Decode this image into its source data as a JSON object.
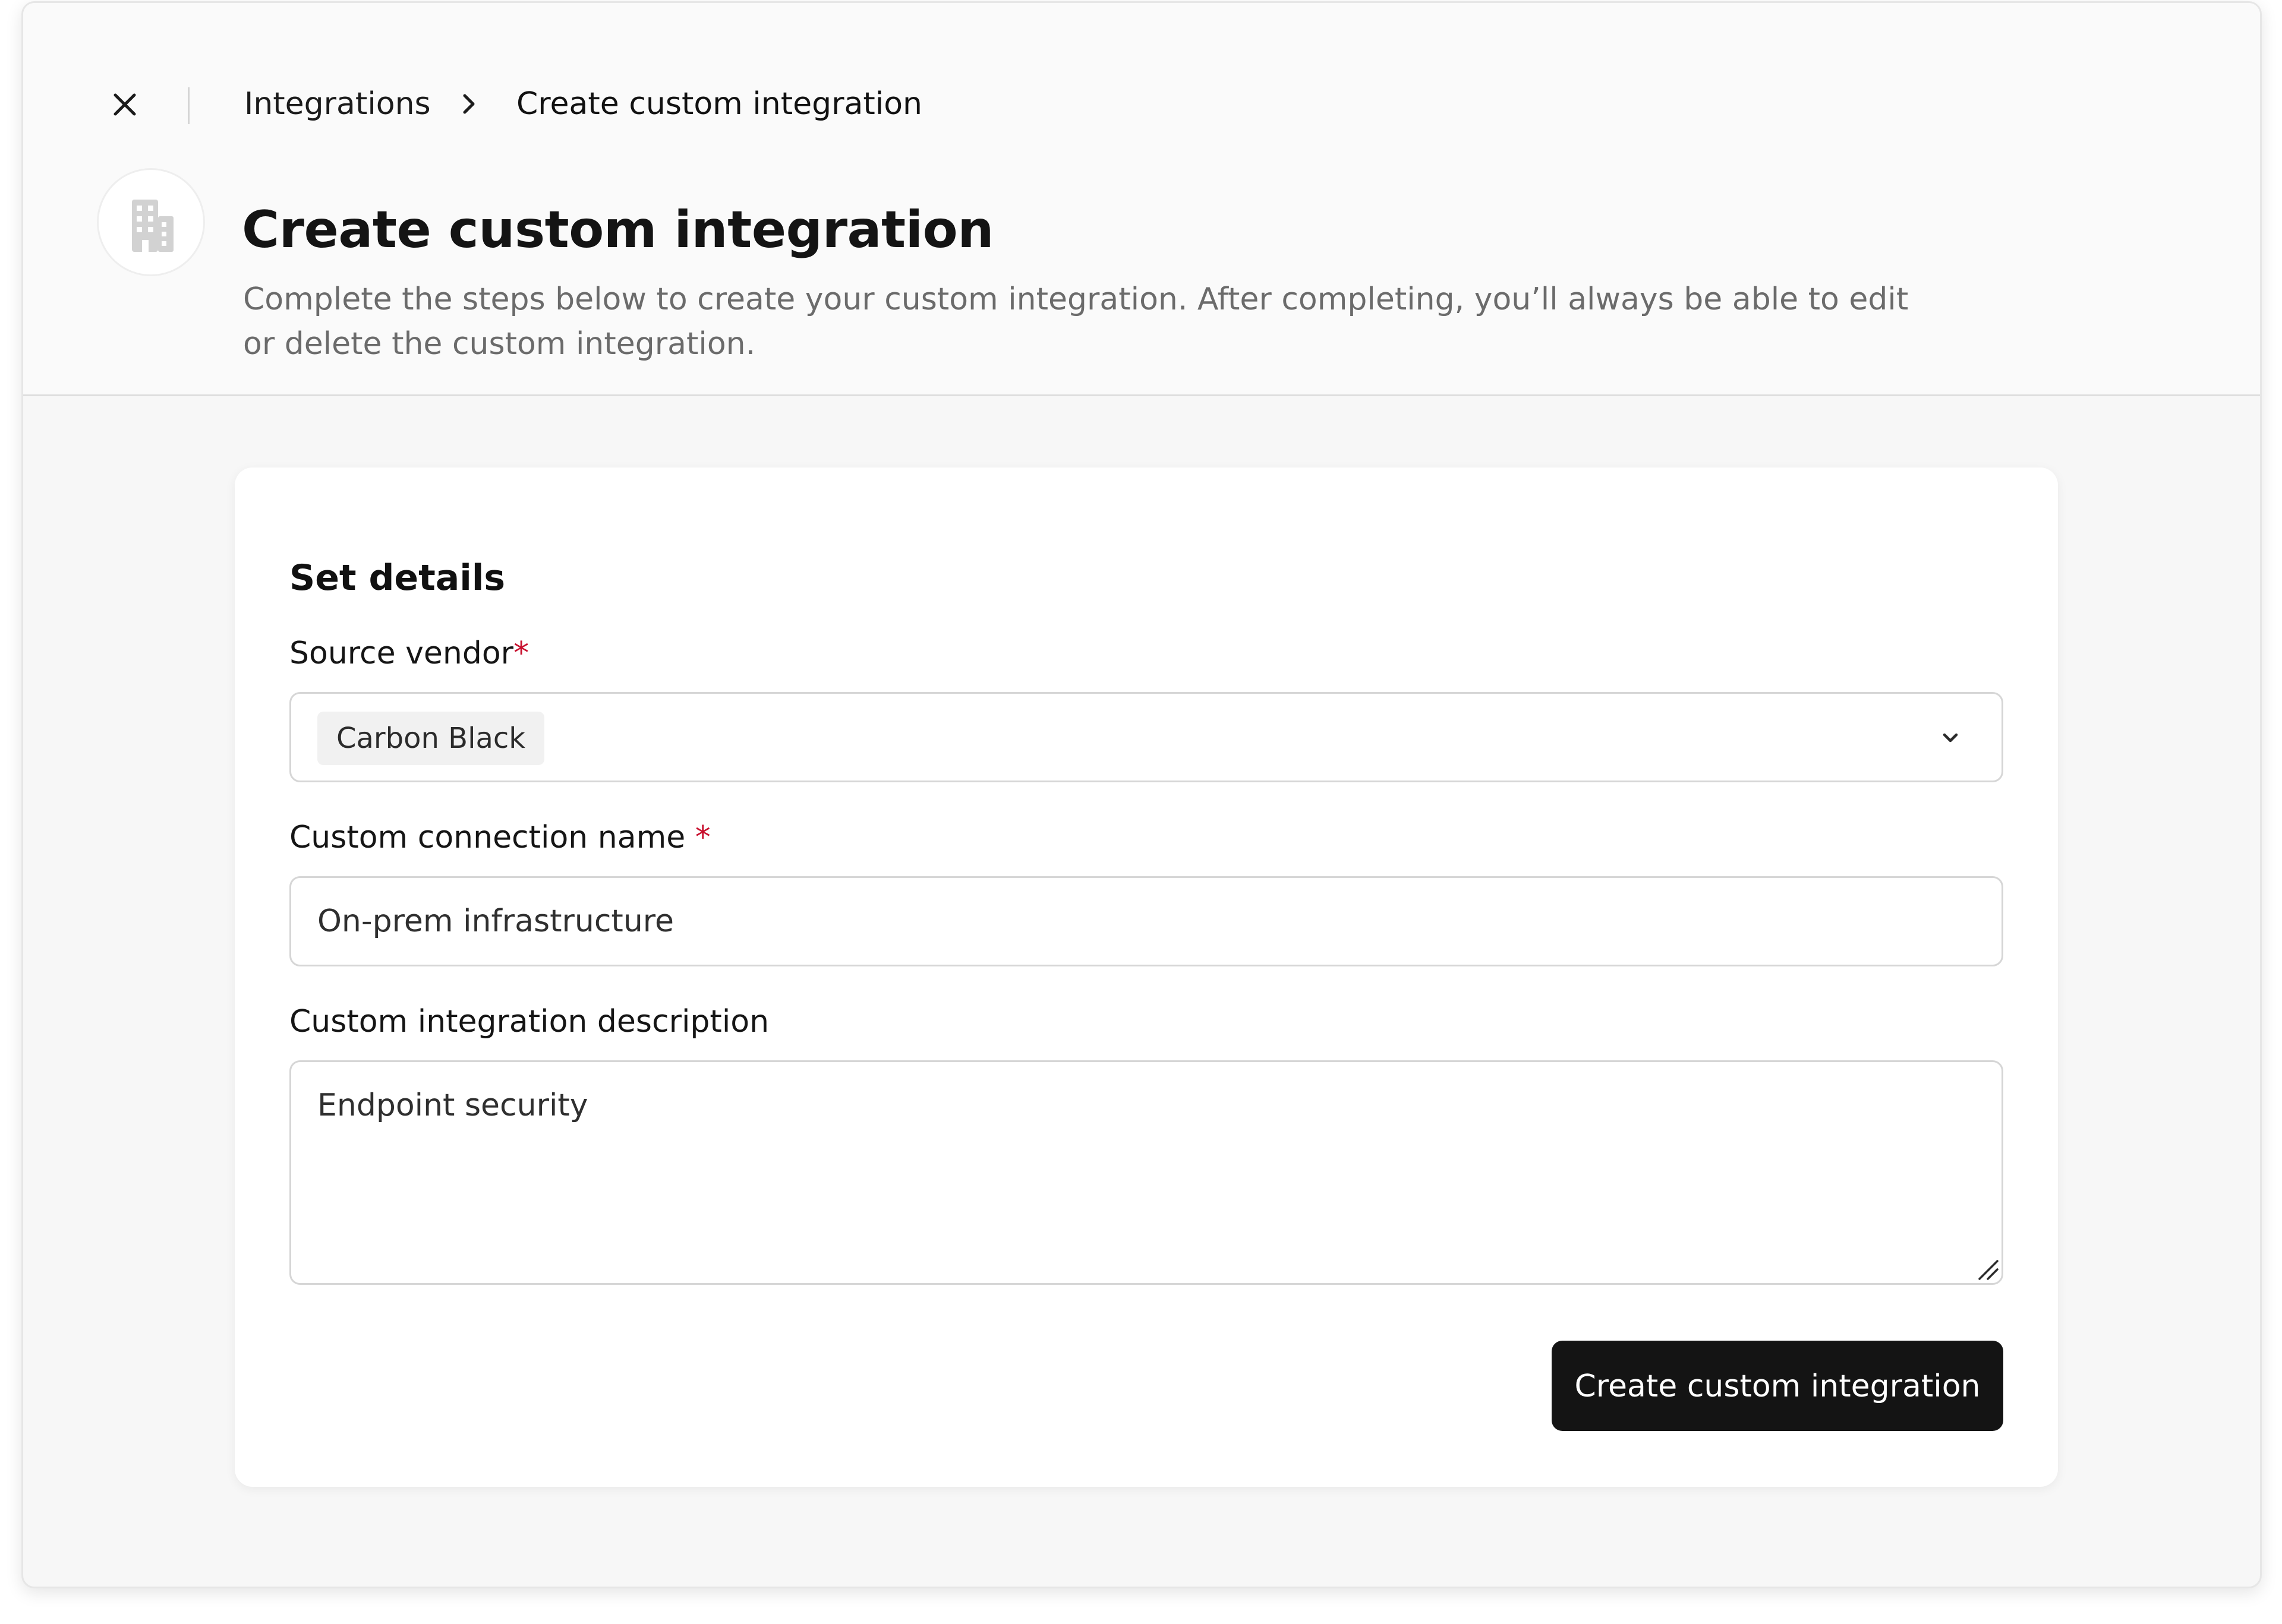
{
  "breadcrumb": {
    "root": "Integrations",
    "current": "Create custom integration"
  },
  "header": {
    "title": "Create custom integration",
    "description": "Complete the steps below to create your custom integration. After completing, you’ll always be able to edit or delete the custom integration.",
    "icon": "building-icon"
  },
  "form": {
    "section_title": "Set details",
    "source_vendor": {
      "label": "Source vendor",
      "required_mark": "*",
      "selected": "Carbon Black"
    },
    "connection_name": {
      "label": "Custom connection name",
      "required_mark": "*",
      "value": "On-prem infrastructure"
    },
    "description": {
      "label": "Custom integration description",
      "value": "Endpoint security"
    },
    "submit_label": "Create custom integration"
  },
  "colors": {
    "required": "#c8102e",
    "primary_button": "#141414",
    "header_background": "#fafafa",
    "page_background": "#f7f7f7"
  }
}
